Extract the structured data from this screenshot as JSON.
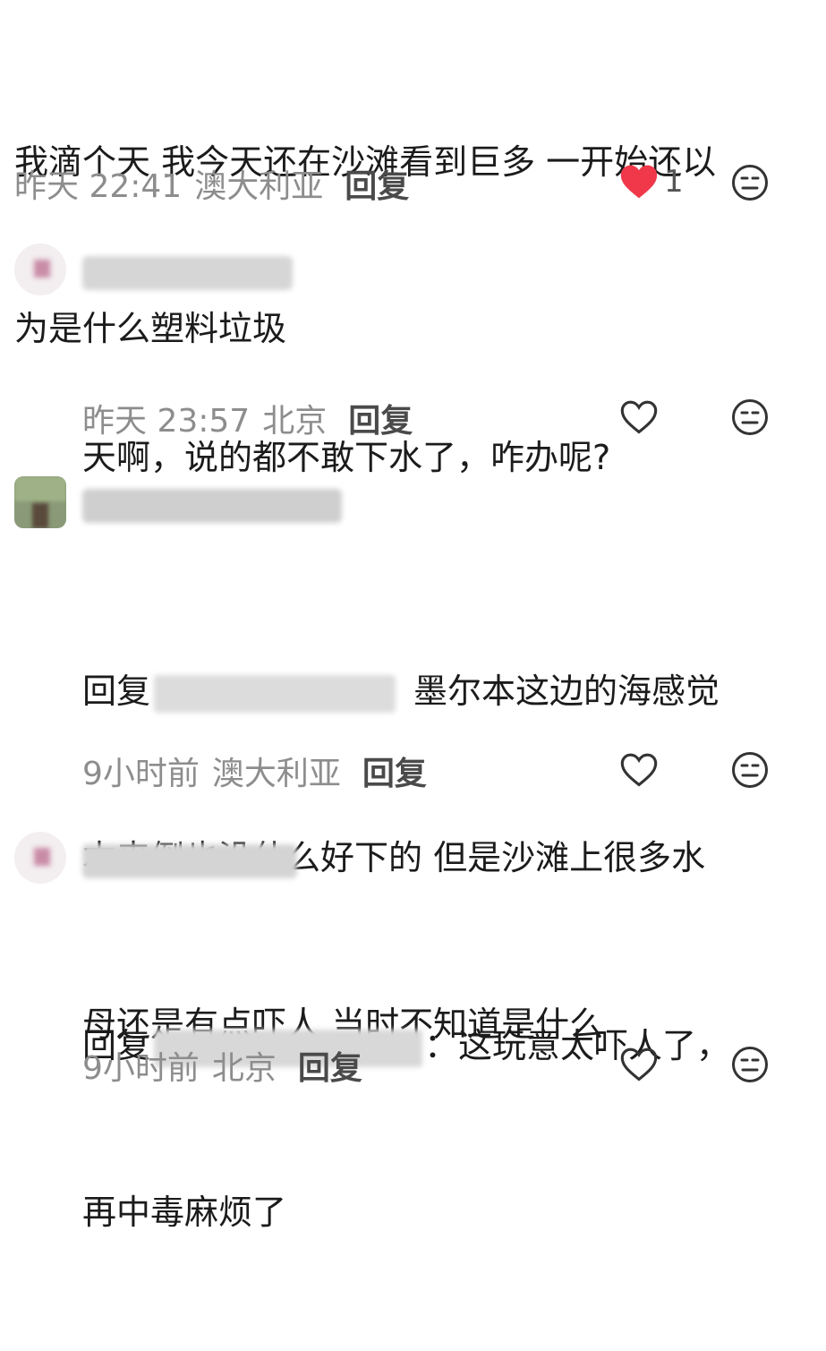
{
  "comments": [
    {
      "text_line1": "我滴个天 我今天还在沙滩看到巨多 一开始还以",
      "text_line2": "为是什么塑料垃圾",
      "time": "昨天 22:41",
      "location": "澳大利亚",
      "reply_label": "回复",
      "like_count": "1",
      "liked": true
    },
    {
      "text_line1": "天啊，说的都不敢下水了，咋办呢?",
      "time": "昨天 23:57",
      "location": "北京",
      "reply_label": "回复",
      "liked": false
    },
    {
      "reply_prefix": "回复",
      "text_line1_tail": "墨尔本这边的海感觉",
      "text_line2": "本来倒也没什么好下的 但是沙滩上很多水",
      "text_line3": "母还是有点吓人 当时不知道是什么",
      "time": "9小时前",
      "location": "澳大利亚",
      "reply_label": "回复",
      "liked": false
    },
    {
      "reply_prefix": "回复",
      "text_line1_tail": "：这玩意太吓人了，",
      "text_line2": "再中毒麻烦了",
      "time": "9小时前",
      "location": "北京",
      "reply_label": "回复",
      "liked": false
    }
  ],
  "colors": {
    "heart_filled": "#f0384a",
    "meta_text": "#8d8d8d",
    "reply_text": "#4a4a4a"
  }
}
